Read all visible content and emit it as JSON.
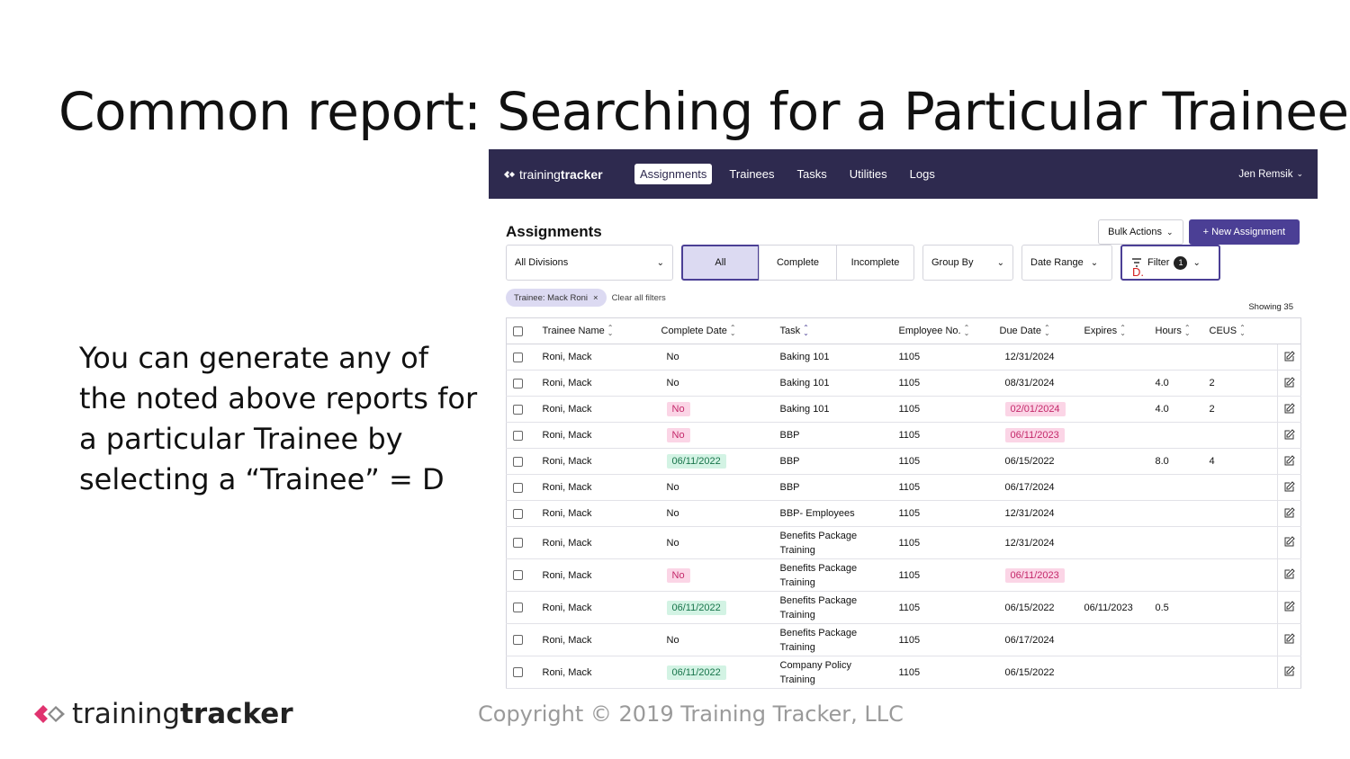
{
  "slide": {
    "title": "Common report: Searching for a Particular Trainee",
    "body": "You can generate any of the noted above reports for a particular Trainee by selecting a “Trainee” = D",
    "copyright": "Copyright © 2019 Training Tracker, LLC",
    "footer_logo": {
      "part1": "training",
      "part2": "tracker"
    }
  },
  "app": {
    "brand": {
      "part1": "training",
      "part2": "tracker"
    },
    "nav": [
      "Assignments",
      "Trainees",
      "Tasks",
      "Utilities",
      "Logs"
    ],
    "user": "Jen Remsik",
    "page_title": "Assignments",
    "bulk_actions": "Bulk Actions",
    "new_assignment": "+ New Assignment",
    "divisions_select": "All Divisions",
    "segments": [
      "All",
      "Complete",
      "Incomplete"
    ],
    "group_by": "Group By",
    "date_range": "Date Range",
    "filter": {
      "label": "Filter",
      "count": "1",
      "annotation": "D."
    },
    "chip": "Trainee: Mack Roni",
    "clear_all": "Clear all filters",
    "showing": "Showing 35",
    "columns": [
      "Trainee Name",
      "Complete Date",
      "Task",
      "Employee No.",
      "Due Date",
      "Expires",
      "Hours",
      "CEUS"
    ],
    "rows": [
      {
        "name": "Roni, Mack",
        "complete": "No",
        "complete_style": "plain",
        "task": "Baking 101",
        "emp": "1105",
        "due": "12/31/2024",
        "due_style": "plain",
        "expires": "",
        "hours": "",
        "ceus": ""
      },
      {
        "name": "Roni, Mack",
        "complete": "No",
        "complete_style": "plain",
        "task": "Baking 101",
        "emp": "1105",
        "due": "08/31/2024",
        "due_style": "plain",
        "expires": "",
        "hours": "4.0",
        "ceus": "2"
      },
      {
        "name": "Roni, Mack",
        "complete": "No",
        "complete_style": "pink",
        "task": "Baking 101",
        "emp": "1105",
        "due": "02/01/2024",
        "due_style": "pink",
        "expires": "",
        "hours": "4.0",
        "ceus": "2"
      },
      {
        "name": "Roni, Mack",
        "complete": "No",
        "complete_style": "pink",
        "task": "BBP",
        "emp": "1105",
        "due": "06/11/2023",
        "due_style": "pink",
        "expires": "",
        "hours": "",
        "ceus": ""
      },
      {
        "name": "Roni, Mack",
        "complete": "06/11/2022",
        "complete_style": "green",
        "task": "BBP",
        "emp": "1105",
        "due": "06/15/2022",
        "due_style": "plain",
        "expires": "",
        "hours": "8.0",
        "ceus": "4"
      },
      {
        "name": "Roni, Mack",
        "complete": "No",
        "complete_style": "plain",
        "task": "BBP",
        "emp": "1105",
        "due": "06/17/2024",
        "due_style": "plain",
        "expires": "",
        "hours": "",
        "ceus": ""
      },
      {
        "name": "Roni, Mack",
        "complete": "No",
        "complete_style": "plain",
        "task": "BBP- Employees",
        "emp": "1105",
        "due": "12/31/2024",
        "due_style": "plain",
        "expires": "",
        "hours": "",
        "ceus": ""
      },
      {
        "name": "Roni, Mack",
        "complete": "No",
        "complete_style": "plain",
        "task": "Benefits Package Training",
        "emp": "1105",
        "due": "12/31/2024",
        "due_style": "plain",
        "expires": "",
        "hours": "",
        "ceus": ""
      },
      {
        "name": "Roni, Mack",
        "complete": "No",
        "complete_style": "pink",
        "task": "Benefits Package Training",
        "emp": "1105",
        "due": "06/11/2023",
        "due_style": "pink",
        "expires": "",
        "hours": "",
        "ceus": ""
      },
      {
        "name": "Roni, Mack",
        "complete": "06/11/2022",
        "complete_style": "green",
        "task": "Benefits Package Training",
        "emp": "1105",
        "due": "06/15/2022",
        "due_style": "plain",
        "expires": "06/11/2023",
        "hours": "0.5",
        "ceus": ""
      },
      {
        "name": "Roni, Mack",
        "complete": "No",
        "complete_style": "plain",
        "task": "Benefits Package Training",
        "emp": "1105",
        "due": "06/17/2024",
        "due_style": "plain",
        "expires": "",
        "hours": "",
        "ceus": ""
      },
      {
        "name": "Roni, Mack",
        "complete": "06/11/2022",
        "complete_style": "green",
        "task": "Company Policy Training",
        "emp": "1105",
        "due": "06/15/2022",
        "due_style": "plain",
        "expires": "",
        "hours": "",
        "ceus": ""
      }
    ]
  },
  "colors": {
    "navbar": "#2e2a4f",
    "accent": "#4b3f95",
    "chip": "#dcdaf2",
    "overdue_bg": "#fbd5e6",
    "overdue_text": "#c4286a",
    "done_bg": "#d3f3e4",
    "done_text": "#17744a",
    "annotation": "#d42020"
  },
  "icons": [
    "brand-logo-icon",
    "chevron-down-icon",
    "filter-icon",
    "close-icon",
    "sort-icon",
    "checkbox-icon",
    "edit-icon"
  ]
}
